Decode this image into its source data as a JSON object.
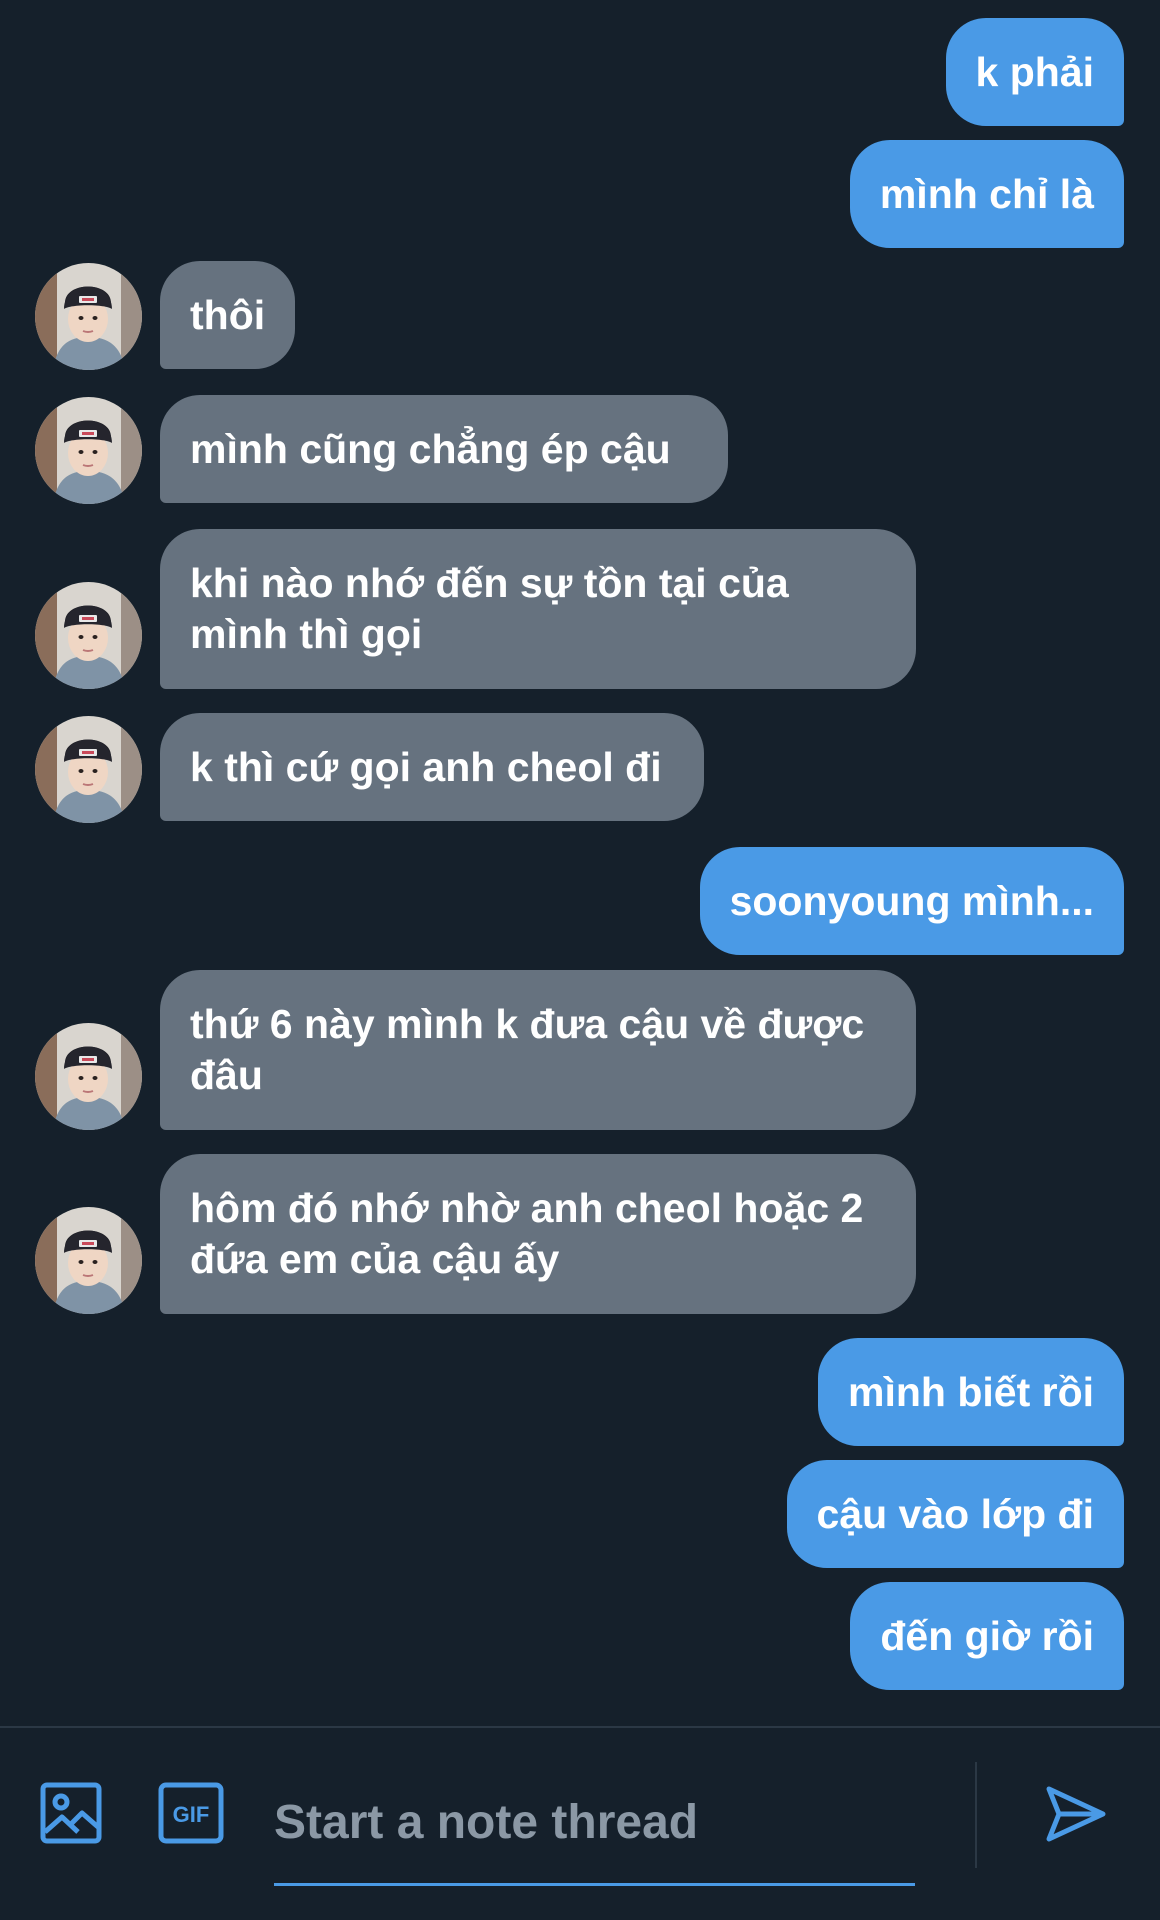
{
  "messages": [
    {
      "sender": "me",
      "text": "k phải"
    },
    {
      "sender": "me",
      "text": "mình chỉ là"
    },
    {
      "sender": "them",
      "text": "thôi"
    },
    {
      "sender": "them",
      "text": "mình cũng chẳng ép cậu"
    },
    {
      "sender": "them",
      "text": "khi nào nhớ đến sự tồn tại của mình thì gọi"
    },
    {
      "sender": "them",
      "text": "k thì cứ gọi anh cheol đi"
    },
    {
      "sender": "me",
      "text": "soonyoung mình..."
    },
    {
      "sender": "them",
      "text": "thứ 6 này mình k đưa cậu về được đâu"
    },
    {
      "sender": "them",
      "text": "hôm đó nhớ nhờ anh cheol hoặc 2 đứa em của cậu ấy"
    },
    {
      "sender": "me",
      "text": "mình biết rồi"
    },
    {
      "sender": "me",
      "text": "cậu vào lớp đi"
    },
    {
      "sender": "me",
      "text": "đến giờ rồi"
    }
  ],
  "composer": {
    "placeholder": "Start a note thread",
    "gif_label": "GIF",
    "icons": [
      "image-icon",
      "gif-icon",
      "send-icon"
    ]
  },
  "colors": {
    "background": "#15202b",
    "sent_bubble": "#4a9ae6",
    "received_bubble": "#66727f",
    "accent": "#4a9ae6",
    "placeholder": "#8b98a5"
  }
}
